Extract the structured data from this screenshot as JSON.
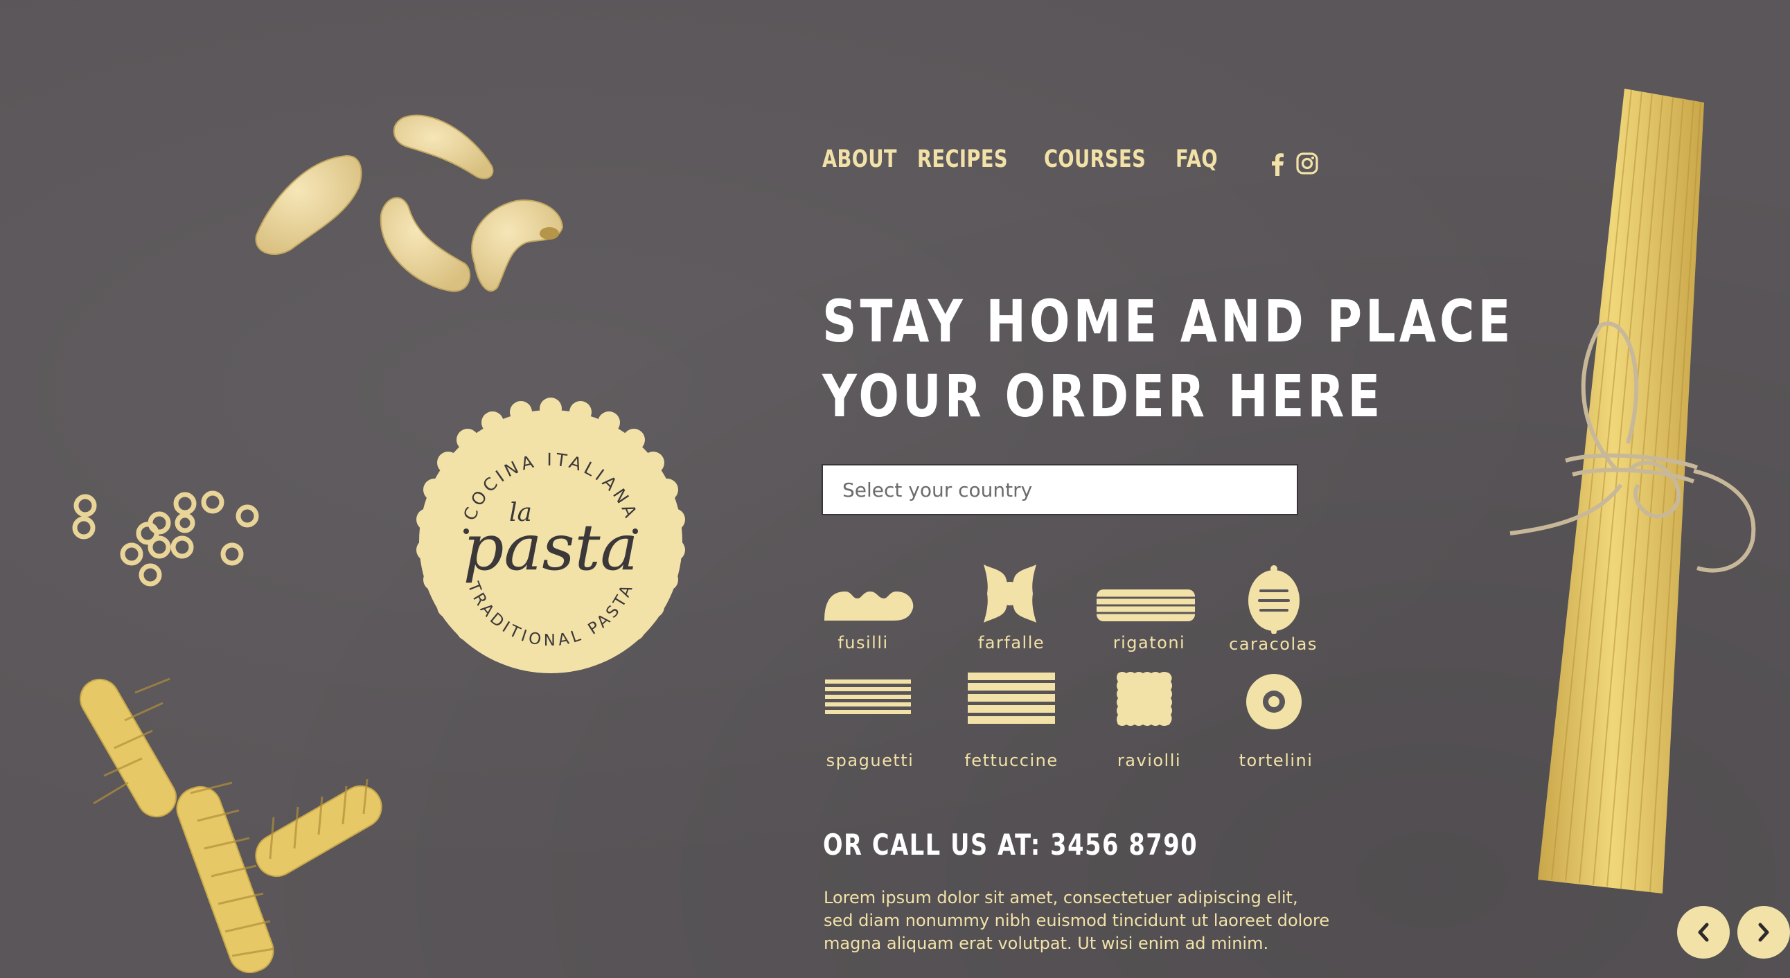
{
  "nav": {
    "items": [
      {
        "label": "ABOUT"
      },
      {
        "label": "RECIPES"
      },
      {
        "label": "COURSES"
      },
      {
        "label": "FAQ"
      }
    ],
    "social": [
      "facebook-icon",
      "instagram-icon"
    ]
  },
  "hero": {
    "title_line1": "STAY HOME AND PLACE",
    "title_line2": "YOUR ORDER HERE"
  },
  "country_select": {
    "placeholder": "Select your country"
  },
  "pasta_types": [
    {
      "label": "fusilli",
      "icon": "fusilli-icon"
    },
    {
      "label": "farfalle",
      "icon": "farfalle-icon"
    },
    {
      "label": "rigatoni",
      "icon": "rigatoni-icon"
    },
    {
      "label": "caracolas",
      "icon": "caracolas-icon"
    },
    {
      "label": "spaguetti",
      "icon": "spaguetti-icon"
    },
    {
      "label": "fettuccine",
      "icon": "fettuccine-icon"
    },
    {
      "label": "raviolli",
      "icon": "raviolli-icon"
    },
    {
      "label": "tortelini",
      "icon": "tortelini-icon"
    }
  ],
  "call": {
    "text": "OR CALL US AT: 3456 8790"
  },
  "description": {
    "line1": "Lorem ipsum dolor sit amet, consectetuer adipiscing elit,",
    "line2": "sed diam nonummy nibh euismod tincidunt ut laoreet dolore",
    "line3": "magna aliquam erat volutpat. Ut wisi enim ad minim."
  },
  "logo": {
    "top_text": "COCINA ITALIANA",
    "script_small": "la",
    "script_main": "pasta",
    "bottom_text": "TRADITIONAL PASTA"
  },
  "carousel": {
    "prev_icon": "chevron-left-icon",
    "next_icon": "chevron-right-icon"
  },
  "colors": {
    "background": "#5a5659",
    "accent": "#f2e2a8",
    "heading": "#ffffff",
    "pasta": "#e8cf7c"
  }
}
